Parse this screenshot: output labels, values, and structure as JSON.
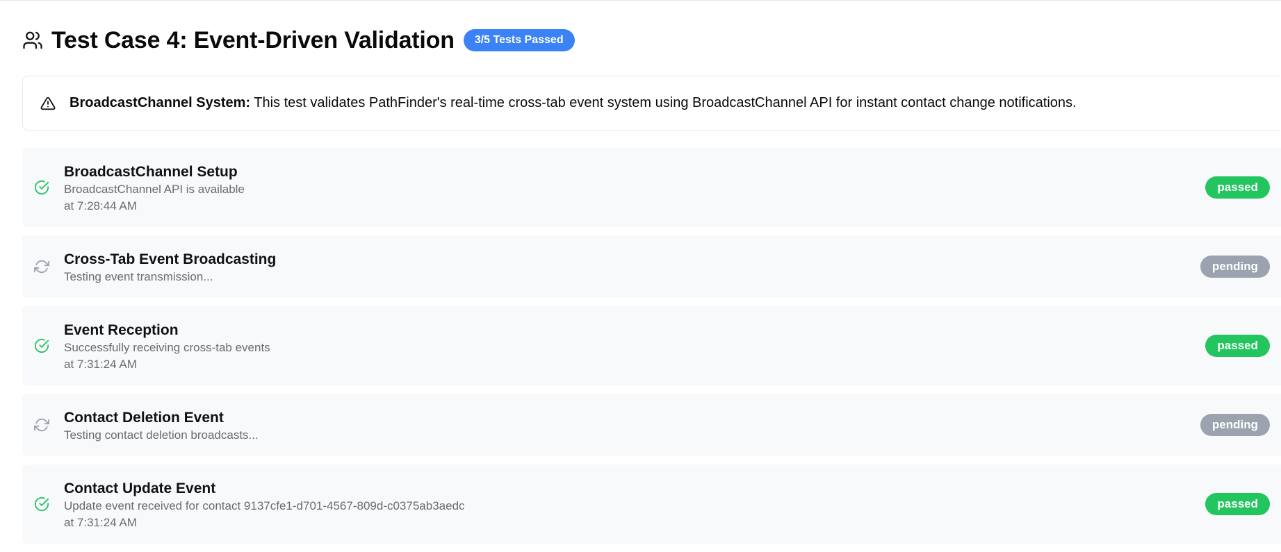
{
  "header": {
    "icon": "users-icon",
    "title": "Test Case 4: Event-Driven Validation",
    "summary_badge": "3/5 Tests Passed",
    "summary_badge_color": "#3b82f6"
  },
  "alert": {
    "icon": "alert-triangle-icon",
    "label": "BroadcastChannel System:",
    "text": " This test validates PathFinder's real-time cross-tab event system using BroadcastChannel API for instant contact change notifications."
  },
  "colors": {
    "passed": "#22c55e",
    "pending": "#9ca3af",
    "row_background": "#f8f9fb"
  },
  "tests": [
    {
      "name": "BroadcastChannel Setup",
      "message": "BroadcastChannel API is available",
      "time": "at 7:28:44 AM",
      "status": "passed",
      "icon": "check-circle-icon"
    },
    {
      "name": "Cross-Tab Event Broadcasting",
      "message": "Testing event transmission...",
      "time": "",
      "status": "pending",
      "icon": "refresh-icon"
    },
    {
      "name": "Event Reception",
      "message": "Successfully receiving cross-tab events",
      "time": "at 7:31:24 AM",
      "status": "passed",
      "icon": "check-circle-icon"
    },
    {
      "name": "Contact Deletion Event",
      "message": "Testing contact deletion broadcasts...",
      "time": "",
      "status": "pending",
      "icon": "refresh-icon"
    },
    {
      "name": "Contact Update Event",
      "message": "Update event received for contact 9137cfe1-d701-4567-809d-c0375ab3aedc",
      "time": "at 7:31:24 AM",
      "status": "passed",
      "icon": "check-circle-icon"
    }
  ]
}
